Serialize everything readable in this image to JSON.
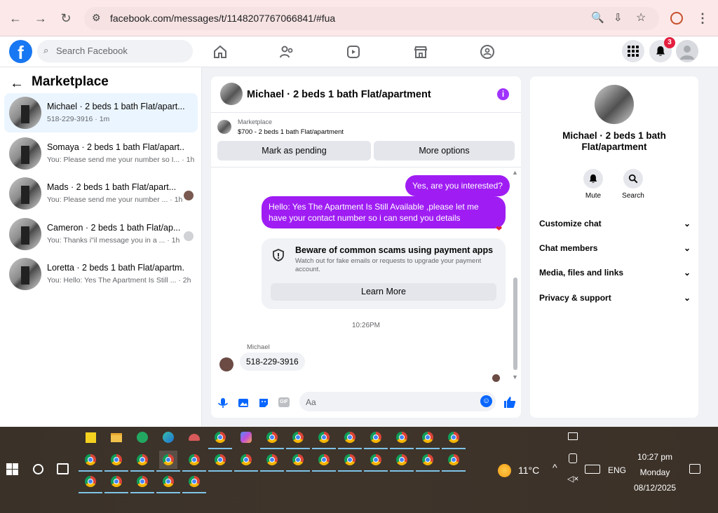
{
  "browser": {
    "url": "facebook.com/messages/t/1148207767066841/#fua"
  },
  "header": {
    "search_placeholder": "Search Facebook",
    "notification_count": "3"
  },
  "left": {
    "title": "Marketplace",
    "conversations": [
      {
        "title": "Michael · 2 beds 1 bath Flat/apart...",
        "sub": "518-229-3916 · 1m"
      },
      {
        "title": "Somaya · 2 beds 1 bath Flat/apart...",
        "sub": "You: Please send me your number so I... · 1h"
      },
      {
        "title": "Mads · 2 beds 1 bath Flat/apart...",
        "sub": "You: Please send me your number ... · 1h"
      },
      {
        "title": "Cameron · 2 beds 1 bath Flat/ap...",
        "sub": "You: Thanks i\"il message you in a ... · 1h"
      },
      {
        "title": "Loretta · 2 beds 1 bath Flat/apartm...",
        "sub": "You: Hello: Yes The Apartment Is Still ... · 2h"
      }
    ]
  },
  "chat": {
    "title": "Michael · 2 beds 1 bath Flat/apartment",
    "marketplace_label": "Marketplace",
    "listing": "$700 - 2 beds 1 bath Flat/apartment",
    "mark_pending": "Mark as pending",
    "more_options": "More options",
    "msg1": "Yes, are you interested?",
    "msg2": "Hello: Yes The Apartment Is Still Available ,please let me have your contact number so i can send you details",
    "scam_title": "Beware of common scams using payment apps",
    "scam_text": "Watch out for fake emails or requests to upgrade your payment account.",
    "learn_more": "Learn More",
    "timestamp": "10:26PM",
    "sender": "Michael",
    "reply": "518-229-3916",
    "input_placeholder": "Aa"
  },
  "right": {
    "title": "Michael · 2 beds 1 bath Flat/apartment",
    "mute": "Mute",
    "search": "Search",
    "rows": [
      "Customize chat",
      "Chat members",
      "Media, files and links",
      "Privacy & support"
    ]
  },
  "taskbar": {
    "temp": "11°C",
    "lang": "ENG",
    "time": "10:27 pm",
    "day": "Monday",
    "date": "08/12/2025"
  },
  "colors": {
    "accent": "#9f1df3",
    "brand": "#1877f2"
  }
}
